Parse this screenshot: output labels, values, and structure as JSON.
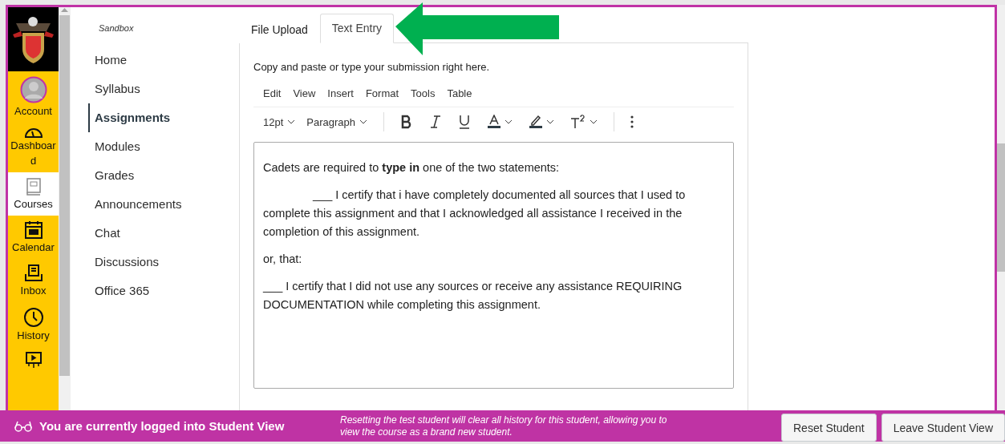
{
  "global_nav": [
    {
      "label": "Account",
      "selected": false
    },
    {
      "label": "Dashboard",
      "selected": false
    },
    {
      "label": "Courses",
      "selected": true
    },
    {
      "label": "Calendar",
      "selected": false
    },
    {
      "label": "Inbox",
      "selected": false
    },
    {
      "label": "History",
      "selected": false
    }
  ],
  "course_nav": {
    "title": "Sandbox",
    "items": [
      {
        "label": "Home",
        "selected": false
      },
      {
        "label": "Syllabus",
        "selected": false
      },
      {
        "label": "Assignments",
        "selected": true
      },
      {
        "label": "Modules",
        "selected": false
      },
      {
        "label": "Grades",
        "selected": false
      },
      {
        "label": "Announcements",
        "selected": false
      },
      {
        "label": "Chat",
        "selected": false
      },
      {
        "label": "Discussions",
        "selected": false
      },
      {
        "label": "Office 365",
        "selected": false
      }
    ]
  },
  "tabs": [
    {
      "label": "File Upload",
      "selected": false
    },
    {
      "label": "Text Entry",
      "selected": true
    }
  ],
  "instructions": "Copy and paste or type your submission right here.",
  "editor": {
    "menu": [
      "Edit",
      "View",
      "Insert",
      "Format",
      "Tools",
      "Table"
    ],
    "font_size": "12pt",
    "block_format": "Paragraph",
    "paragraphs": [
      {
        "text": "Cadets are required to **type in** one of the two statements:",
        "indent": false
      },
      {
        "text": "___ I certify that i have completely documented all sources that I used to complete this assignment and that I acknowledged all assistance I received in the completion of this assignment.",
        "indent": true
      },
      {
        "text": "or, that:",
        "indent": false
      },
      {
        "text": "___ I certify that I did not use any sources or receive any assistance REQUIRING DOCUMENTATION while completing this assignment.",
        "indent": false
      }
    ]
  },
  "student_view_bar": {
    "message": "You are currently logged into Student View",
    "note": "Resetting the test student will clear all history for this student, allowing you to view the course as a brand new student.",
    "buttons": [
      "Reset Student",
      "Leave Student View"
    ]
  }
}
